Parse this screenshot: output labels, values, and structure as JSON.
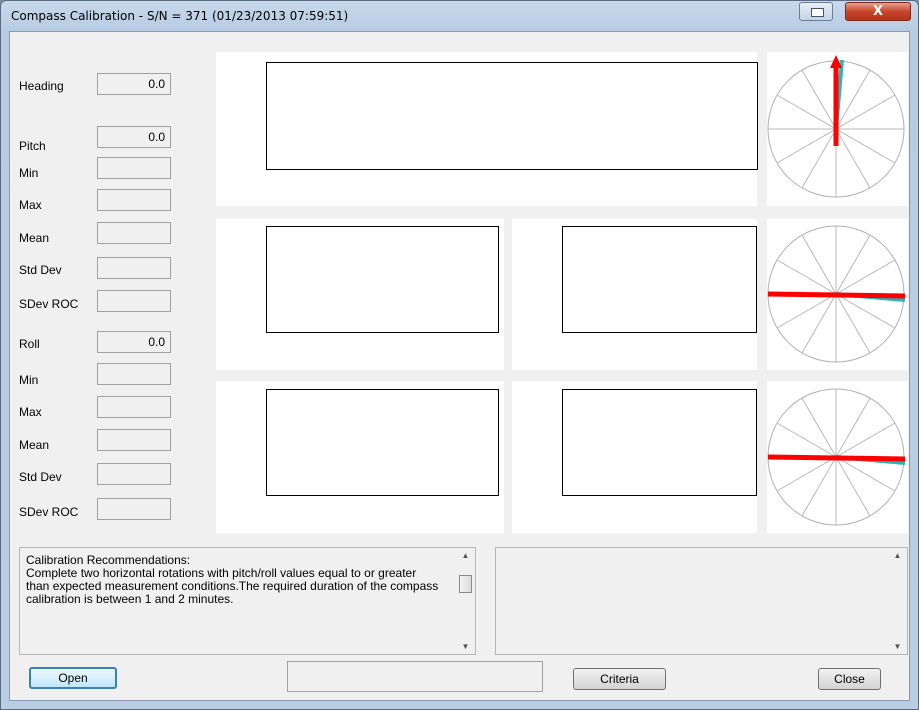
{
  "window": {
    "title": "Compass Calibration - S/N = 371 (01/23/2013 07:59:51)",
    "close_glyph": "X"
  },
  "fields": {
    "heading": {
      "label": "Heading",
      "value": "0.0"
    },
    "pitch": {
      "label": "Pitch",
      "value": "0.0"
    },
    "pitch_stats": [
      {
        "label": "Min",
        "value": ""
      },
      {
        "label": "Max",
        "value": ""
      },
      {
        "label": "Mean",
        "value": ""
      },
      {
        "label": "Std Dev",
        "value": ""
      },
      {
        "label": "SDev ROC",
        "value": ""
      }
    ],
    "roll": {
      "label": "Roll",
      "value": "0.0"
    },
    "roll_stats": [
      {
        "label": "Min",
        "value": ""
      },
      {
        "label": "Max",
        "value": ""
      },
      {
        "label": "Mean",
        "value": ""
      },
      {
        "label": "Std Dev",
        "value": ""
      },
      {
        "label": "SDev ROC",
        "value": ""
      }
    ]
  },
  "recommendations": {
    "title": "Calibration Recommendations:",
    "body": "Complete two horizontal rotations with pitch/roll values equal to or greater than expected measurement conditions.The required duration of the compass calibration is between 1 and 2 minutes."
  },
  "status_text": "",
  "buttons": {
    "open": "Open",
    "criteria": "Criteria",
    "close": "Close"
  },
  "compasses": [
    {
      "name": "heading",
      "value_deg": 0
    },
    {
      "name": "pitch",
      "value_deg": 0
    },
    {
      "name": "roll",
      "value_deg": 0
    }
  ],
  "colors": {
    "needle": "#ff0000",
    "reference": "#2bb5b5",
    "default_button_border": "#3c7fb1"
  }
}
